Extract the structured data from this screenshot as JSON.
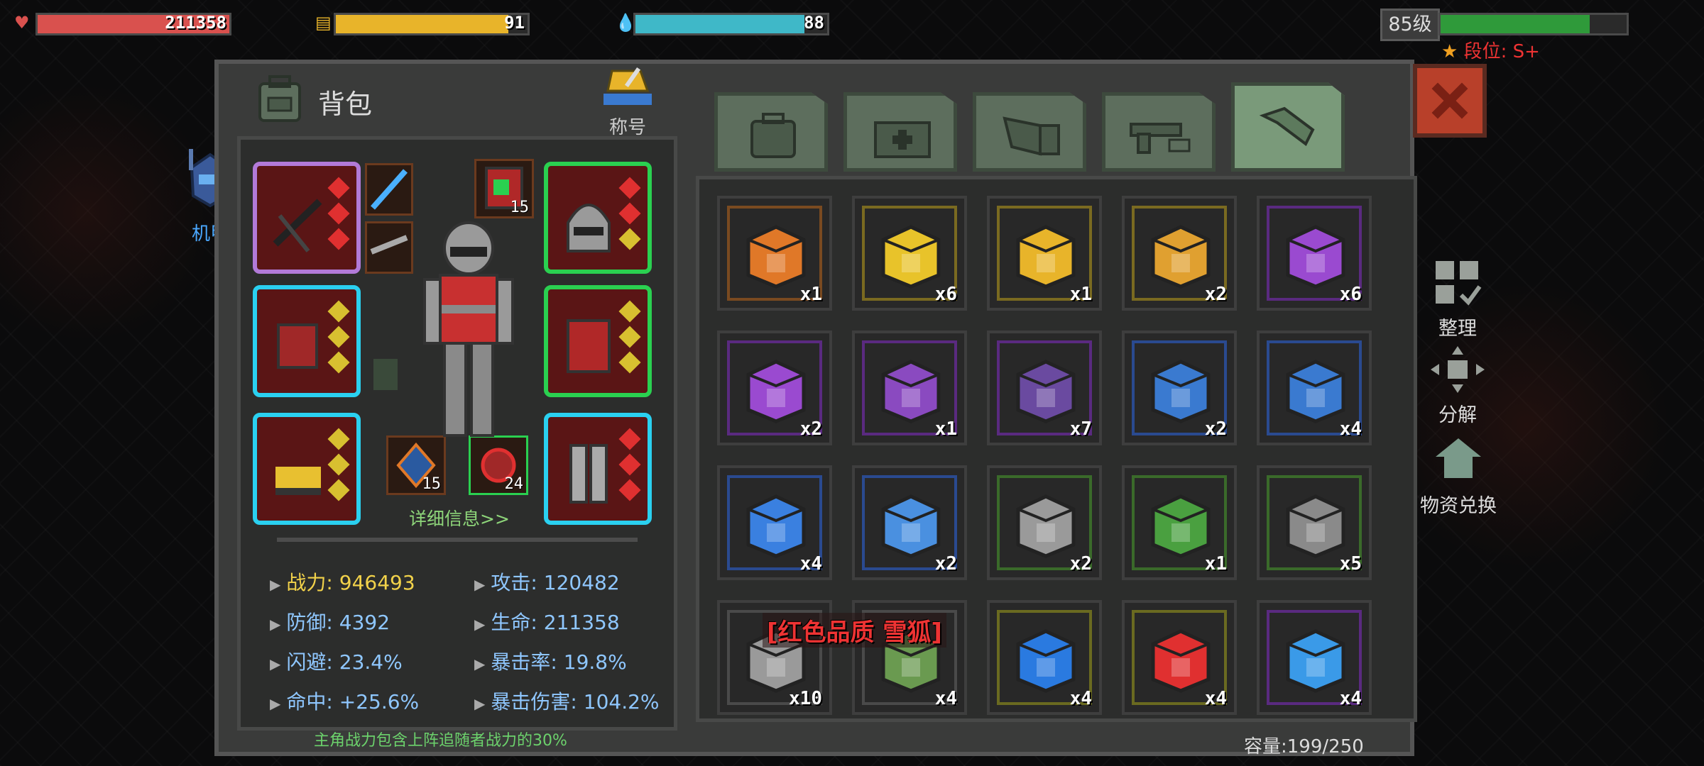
{
  "hud": {
    "hp": {
      "value": "211358",
      "fill": 1.0,
      "color": "#d9514e"
    },
    "food": {
      "value": "91",
      "fill": 0.9,
      "color": "#e8b42a"
    },
    "water": {
      "value": "88",
      "fill": 0.88,
      "color": "#3fb8c8"
    },
    "level": "85级",
    "level_fill": 0.8,
    "level_color": "#2f9a3a",
    "rank": "段位: S+"
  },
  "panel": {
    "title": "背包",
    "badge_label": "称号",
    "mech_label": "机甲",
    "tabs": [
      "backpack-icon",
      "medkit-icon",
      "wing-armor-icon",
      "gun-icon",
      "wrench-icon"
    ],
    "active_tab": 4
  },
  "equipment": {
    "sub_counts": [
      "15",
      "15",
      "24"
    ],
    "detail_link": "详细信息>>"
  },
  "stats": [
    {
      "label": "战力",
      "value": "946493",
      "highlight": true
    },
    {
      "label": "攻击",
      "value": "120482"
    },
    {
      "label": "防御",
      "value": "4392"
    },
    {
      "label": "生命",
      "value": "211358"
    },
    {
      "label": "闪避",
      "value": "23.4%"
    },
    {
      "label": "暴击率",
      "value": "19.8%"
    },
    {
      "label": "命中",
      "value": "+25.6%"
    },
    {
      "label": "暴击伤害",
      "value": "104.2%"
    }
  ],
  "footnote": "主角战力包含上阵追随者战力的30%",
  "capacity": "容量:199/250",
  "tooltip": "[红色品质 雪狐]",
  "side_buttons": [
    "整理",
    "分解",
    "物资兑换"
  ],
  "items": [
    {
      "qty": "x1",
      "color": "#e07828",
      "border": "#7a4a20"
    },
    {
      "qty": "x6",
      "color": "#e8c32a",
      "border": "#7a6a20"
    },
    {
      "qty": "x1",
      "color": "#e8b42a",
      "border": "#7a6a20"
    },
    {
      "qty": "x2",
      "color": "#e0a030",
      "border": "#7a6a20"
    },
    {
      "qty": "x6",
      "color": "#9a4ad0",
      "border": "#5a2a80"
    },
    {
      "qty": "x2",
      "color": "#9a4ad0",
      "border": "#5a2a80"
    },
    {
      "qty": "x1",
      "color": "#8a4ac0",
      "border": "#5a2a80"
    },
    {
      "qty": "x7",
      "color": "#6a4aa0",
      "border": "#5a2a80"
    },
    {
      "qty": "x2",
      "color": "#3a7ad0",
      "border": "#2a4a90"
    },
    {
      "qty": "x4",
      "color": "#3a7ad0",
      "border": "#2a4a90"
    },
    {
      "qty": "x4",
      "color": "#3a80e0",
      "border": "#2a4a90"
    },
    {
      "qty": "x2",
      "color": "#4a90e0",
      "border": "#2a4a90"
    },
    {
      "qty": "x2",
      "color": "#9a9a9a",
      "border": "#3a6a2a"
    },
    {
      "qty": "x1",
      "color": "#4aa040",
      "border": "#3a6a2a"
    },
    {
      "qty": "x5",
      "color": "#8a8a8a",
      "border": "#3a6a2a"
    },
    {
      "qty": "x10",
      "color": "#9a9a9a",
      "border": "#4a4a4a"
    },
    {
      "qty": "x4",
      "color": "#6a9a50",
      "border": "#4a4a4a"
    },
    {
      "qty": "x4",
      "color": "#2a7ae0",
      "border": "#6a6a20"
    },
    {
      "qty": "x4",
      "color": "#e03030",
      "border": "#6a6a20"
    },
    {
      "qty": "x4",
      "color": "#3a9ae8",
      "border": "#5a2a80"
    }
  ]
}
